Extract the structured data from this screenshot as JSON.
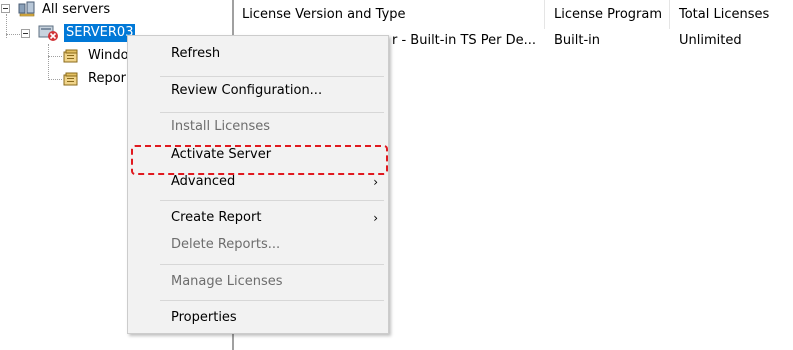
{
  "tree": {
    "root_label": "All servers",
    "server_label": "SERVER03",
    "children": [
      {
        "label": "Windo",
        "icon": "license-pack-icon"
      },
      {
        "label": "Repor",
        "icon": "report-icon"
      }
    ]
  },
  "list": {
    "columns": [
      "License Version and Type",
      "License Program",
      "Total Licenses"
    ],
    "rows": [
      {
        "version_visible": "r - Built-in TS Per De...",
        "program": "Built-in",
        "total": "Unlimited"
      }
    ]
  },
  "context_menu": {
    "items": [
      {
        "label": "Refresh",
        "enabled": true
      },
      {
        "label": "Review Configuration...",
        "enabled": true
      },
      {
        "label": "Install Licenses",
        "enabled": false
      },
      {
        "label": "Activate Server",
        "enabled": true,
        "highlighted": true
      },
      {
        "label": "Advanced",
        "enabled": true,
        "submenu": true
      },
      {
        "label": "Create Report",
        "enabled": true,
        "submenu": true
      },
      {
        "label": "Delete Reports...",
        "enabled": false
      },
      {
        "label": "Manage Licenses",
        "enabled": false
      },
      {
        "label": "Properties",
        "enabled": true
      }
    ],
    "submenu_glyph": "›"
  },
  "colors": {
    "selection": "#0078d7",
    "highlight_box": "#e0191f",
    "disabled_text": "#6d6d6d"
  }
}
